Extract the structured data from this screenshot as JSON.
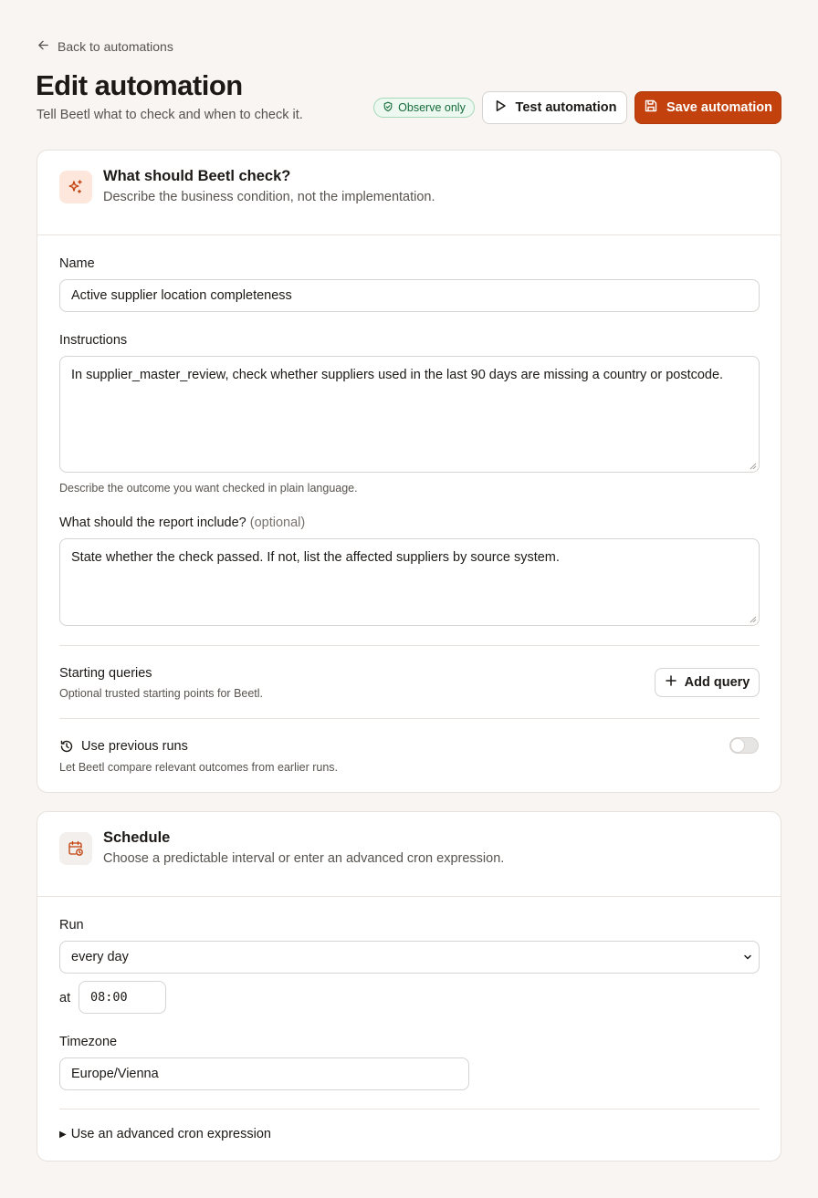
{
  "header": {
    "back_label": "Back to automations",
    "title": "Edit automation",
    "subtitle": "Tell Beetl what to check and when to check it.",
    "badge_label": "Observe only",
    "test_label": "Test automation",
    "save_label": "Save automation"
  },
  "check_card": {
    "title": "What should Beetl check?",
    "subtitle": "Describe the business condition, not the implementation.",
    "name_label": "Name",
    "name_value": "Active supplier location completeness",
    "instructions_label": "Instructions",
    "instructions_value": "In supplier_master_review, check whether suppliers used in the last 90 days are missing a country or postcode.",
    "instructions_hint": "Describe the outcome you want checked in plain language.",
    "report_label": "What should the report include?",
    "report_optional": "(optional)",
    "report_value": "State whether the check passed. If not, list the affected suppliers by source system.",
    "queries_title": "Starting queries",
    "queries_hint": "Optional trusted starting points for Beetl.",
    "add_query_label": "Add query",
    "previous_runs_label": "Use previous runs",
    "previous_runs_hint": "Let Beetl compare relevant outcomes from earlier runs.",
    "previous_runs_enabled": false
  },
  "schedule_card": {
    "title": "Schedule",
    "subtitle": "Choose a predictable interval or enter an advanced cron expression.",
    "run_label": "Run",
    "run_value": "every day",
    "at_label": "at",
    "time_value": "08:00",
    "timezone_label": "Timezone",
    "timezone_value": "Europe/Vienna",
    "advanced_label": "Use an advanced cron expression"
  },
  "colors": {
    "accent": "#c2410c",
    "badge_green": "#156b3a",
    "background": "#f8f5f2"
  }
}
